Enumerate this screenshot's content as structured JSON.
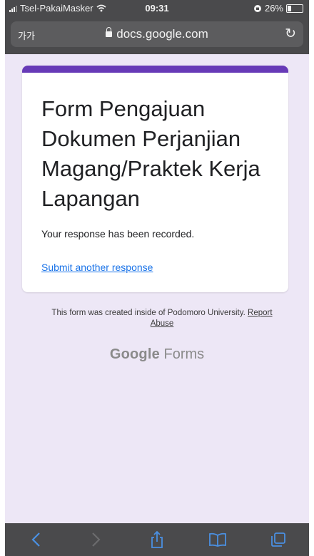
{
  "status_bar": {
    "carrier": "Tsel-PakaiMasker",
    "time": "09:31",
    "battery": "26%",
    "battery_level": 0.26
  },
  "browser": {
    "text_size_label": "가가",
    "url": "docs.google.com"
  },
  "form": {
    "title": "Form Pengajuan Dokumen Perjanjian Magang/Praktek Kerja Lapangan",
    "confirmation": "Your response has been recorded.",
    "submit_another": "Submit another response",
    "accent_color": "#673ab7"
  },
  "footer": {
    "note": "This form was created inside of Podomoro University.",
    "report_link": "Report Abuse",
    "brand_google": "Google",
    "brand_forms": "Forms"
  },
  "toolbar": {
    "icons": [
      "back-icon",
      "forward-icon",
      "share-icon",
      "bookmarks-icon",
      "tabs-icon"
    ]
  }
}
